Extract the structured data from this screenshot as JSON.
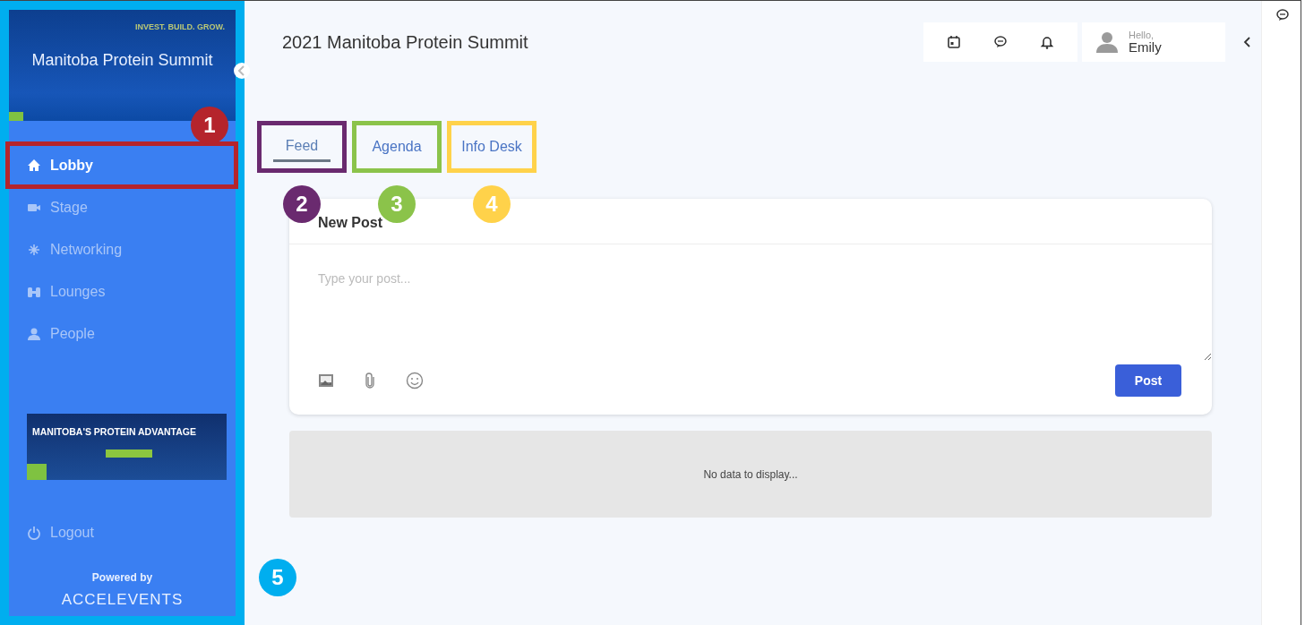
{
  "sidebar": {
    "callout": {
      "number": "5",
      "color": "#00aeef"
    },
    "banner": {
      "tagline": "INVEST. BUILD. GROW.",
      "title": "Manitoba Protein Summit"
    },
    "nav": [
      {
        "label": "Lobby",
        "selected": true,
        "callout": {
          "number": "1",
          "color": "#b5242c"
        }
      },
      {
        "label": "Stage",
        "selected": false
      },
      {
        "label": "Networking",
        "selected": false
      },
      {
        "label": "Lounges",
        "selected": false
      },
      {
        "label": "People",
        "selected": false
      }
    ],
    "ad": {
      "title": "MANITOBA'S PROTEIN ADVANTAGE"
    },
    "logout": "Logout",
    "powered_by": "Powered by",
    "brand": "ACCELEVENTS"
  },
  "header": {
    "title": "2021 Manitoba Protein Summit",
    "greeting": "Hello,",
    "user": "Emily"
  },
  "tabs": [
    {
      "label": "Feed",
      "selected": true,
      "callout": {
        "number": "2",
        "color": "#6a2a6f"
      }
    },
    {
      "label": "Agenda",
      "selected": false,
      "callout": {
        "number": "3",
        "color": "#8bc34a"
      }
    },
    {
      "label": "Info Desk",
      "selected": false,
      "callout": {
        "number": "4",
        "color": "#ffd24a"
      }
    }
  ],
  "new_post": {
    "title": "New Post",
    "placeholder": "Type your post...",
    "button": "Post"
  },
  "empty_message": "No data to display..."
}
